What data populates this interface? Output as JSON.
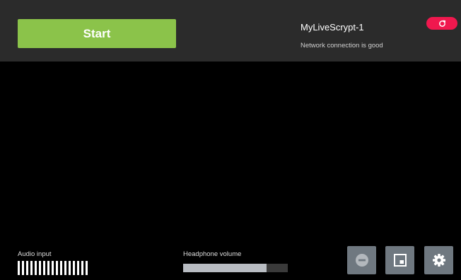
{
  "header": {
    "start_label": "Start",
    "stream_name": "MyLiveScrypt-1",
    "network_status": "Network connection is good"
  },
  "audio": {
    "input_label": "Audio input",
    "meter_bars": 17
  },
  "headphone": {
    "label": "Headphone volume",
    "volume_percent": 80
  },
  "toolbar": {
    "buttons": [
      {
        "name": "remove-icon"
      },
      {
        "name": "picture-in-picture-icon"
      },
      {
        "name": "gear-icon"
      }
    ]
  },
  "colors": {
    "start_green": "#8bc34a",
    "refresh_red": "#f0184e",
    "topbar_bg": "#2b2b2b",
    "tool_button_bg": "#6f7880",
    "volume_fill": "#b8bcc2"
  }
}
